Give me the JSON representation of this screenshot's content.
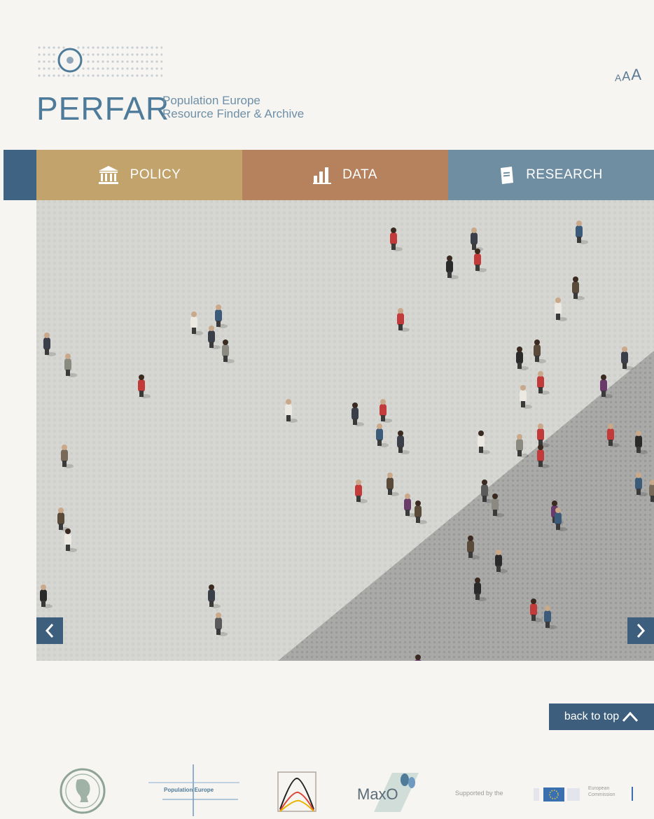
{
  "header": {
    "logo_word": "PERFAR",
    "logo_sub_line1": "Population Europe",
    "logo_sub_line2": "Resource Finder & Archive",
    "font_size_controls": [
      "A",
      "A",
      "A"
    ]
  },
  "nav": {
    "items": [
      {
        "label": "POLICY",
        "icon": "bank-icon",
        "color": "#c2a36b"
      },
      {
        "label": "DATA",
        "icon": "bar-chart-icon",
        "color": "#b5825d"
      },
      {
        "label": "RESEARCH",
        "icon": "document-icon",
        "color": "#6f8ea2"
      }
    ],
    "left_color": "#3f6483"
  },
  "slider": {
    "prev_icon": "chevron-left-icon",
    "next_icon": "chevron-right-icon"
  },
  "back_to_top": {
    "label": "back to top",
    "icon": "chevron-up-icon"
  },
  "footer": {
    "population_europe": "Population Europe",
    "maxo": "MaxO",
    "supported_by": "Supported by the",
    "european_commission_line1": "European",
    "european_commission_line2": "Commission"
  },
  "colors": {
    "background": "#f6f5f1",
    "brand_blue": "#4f7b9a",
    "dark_blue": "#3d5f7d"
  }
}
